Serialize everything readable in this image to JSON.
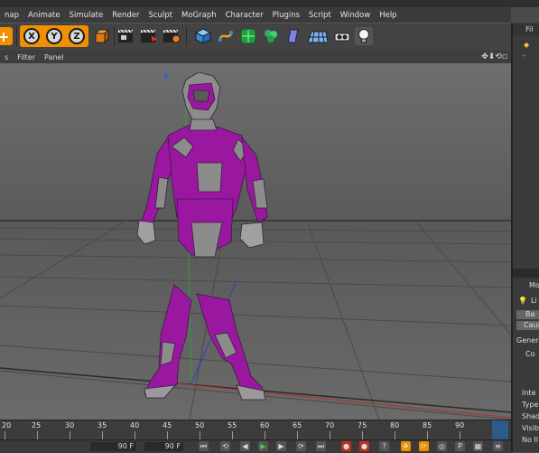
{
  "menu": [
    "nap",
    "Animate",
    "Simulate",
    "Render",
    "Sculpt",
    "MoGraph",
    "Character",
    "Plugins",
    "Script",
    "Window",
    "Help"
  ],
  "toolbar": {
    "axes": [
      "X",
      "Y",
      "Z"
    ]
  },
  "viewport_menu": {
    "items": [
      "s",
      "Filter",
      "Panel"
    ],
    "nav_icons": "✥⬇⟲▫"
  },
  "timeline": {
    "ticks": [
      "20",
      "25",
      "30",
      "35",
      "40",
      "45",
      "50",
      "55",
      "60",
      "65",
      "70",
      "75",
      "80",
      "85",
      "90"
    ]
  },
  "playbar": {
    "start_field": "90 F",
    "end_field": "90 F"
  },
  "right_panel": {
    "top_tab": "Fil",
    "attr_tab": "Mo",
    "object_label": "Li",
    "tab_bas": "Ba",
    "tab_caus": "Caus",
    "section_general": "Genera",
    "field_co": "Co",
    "props": [
      "Inte",
      "Type",
      "Shad",
      "Visib",
      "No Il"
    ]
  },
  "colors": {
    "accent": "#f09000",
    "suit_purple": "#9a18a0",
    "suit_gray": "#8c8c8c"
  }
}
